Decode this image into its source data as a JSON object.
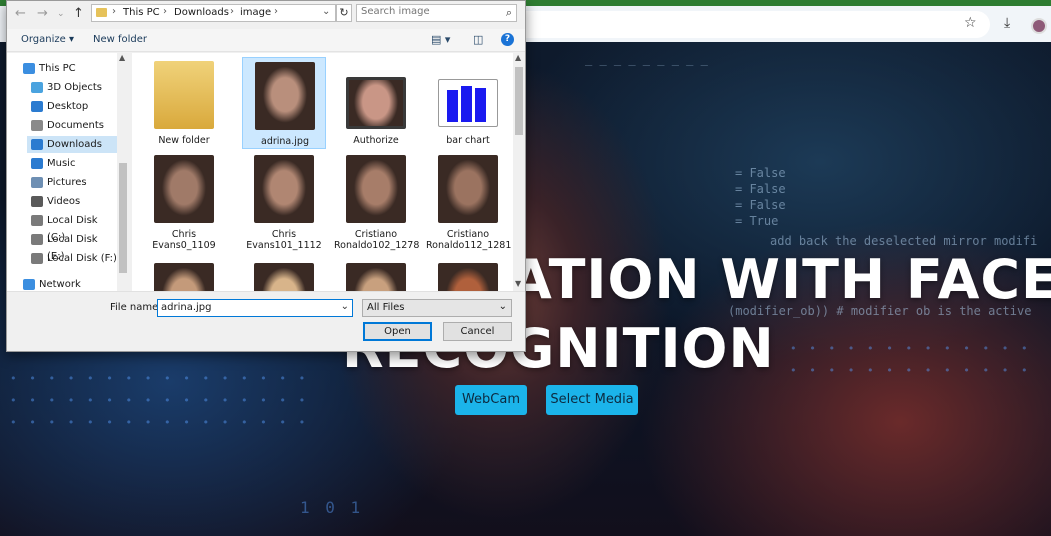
{
  "browser": {
    "colors": {
      "top_strip": "#2e7d32",
      "bar": "#f1f5f9"
    },
    "icons": [
      "star-icon",
      "download-icon",
      "profile-avatar"
    ]
  },
  "page": {
    "headline_line1": "ATION WITH FACE",
    "headline_line2": "RECOGNITION",
    "buttons": {
      "webcam": "WebCam",
      "select_media": "Select Media"
    },
    "accent_color": "#1bb4ea",
    "code_lines": [
      "= False",
      "= False",
      "= False",
      "= True",
      "add back the deselected mirror modifi",
      "(modifier_ob)) # modifier ob is the active"
    ],
    "dots_text": "1 0 1"
  },
  "dialog": {
    "address": {
      "crumbs": [
        "This PC",
        "Downloads",
        "image"
      ]
    },
    "search_placeholder": "Search image",
    "toolbar": {
      "organize": "Organize",
      "new_folder": "New folder",
      "help": "?"
    },
    "sidebar": [
      {
        "label": "This PC",
        "icon": "computer-icon",
        "color": "#3b8ee0"
      },
      {
        "label": "3D Objects",
        "icon": "cube-icon",
        "color": "#4aa3df"
      },
      {
        "label": "Desktop",
        "icon": "desktop-icon",
        "color": "#2b7bd0"
      },
      {
        "label": "Documents",
        "icon": "documents-icon",
        "color": "#8a8a8a"
      },
      {
        "label": "Downloads",
        "icon": "download-arrow-icon",
        "color": "#2b7bd0",
        "selected": true
      },
      {
        "label": "Music",
        "icon": "music-icon",
        "color": "#2b7bd0"
      },
      {
        "label": "Pictures",
        "icon": "pictures-icon",
        "color": "#6e8fb3"
      },
      {
        "label": "Videos",
        "icon": "videos-icon",
        "color": "#5a5a5a"
      },
      {
        "label": "Local Disk (C:)",
        "icon": "disk-icon",
        "color": "#7a7a7a"
      },
      {
        "label": "Local Disk (E:)",
        "icon": "disk-icon",
        "color": "#7a7a7a"
      },
      {
        "label": "Local Disk (F:)",
        "icon": "disk-icon",
        "color": "#7a7a7a"
      },
      {
        "label": "Network",
        "icon": "network-icon",
        "color": "#3b8ee0"
      }
    ],
    "files": [
      {
        "name": "New folder",
        "kind": "folder"
      },
      {
        "name": "adrina.jpg",
        "kind": "photo",
        "selected": true,
        "tone": "#b98f7c"
      },
      {
        "name": "Authorize",
        "kind": "photo-framed",
        "tone": "#c99686"
      },
      {
        "name": "bar chart",
        "kind": "chart"
      },
      {
        "name": "Chris Evans0_1109",
        "kind": "photo",
        "tone": "#a07a68"
      },
      {
        "name": "Chris Evans101_1112",
        "kind": "photo",
        "tone": "#b08672"
      },
      {
        "name": "Cristiano Ronaldo102_1278",
        "kind": "photo",
        "tone": "#a77d69"
      },
      {
        "name": "Cristiano Ronaldo112_1281",
        "kind": "photo",
        "tone": "#9b7360"
      },
      {
        "name": "",
        "kind": "photo",
        "tone": "#c49a7a"
      },
      {
        "name": "",
        "kind": "photo",
        "tone": "#d8b48a"
      },
      {
        "name": "",
        "kind": "photo",
        "tone": "#c8a07e"
      },
      {
        "name": "",
        "kind": "photo",
        "tone": "#b0603c"
      }
    ],
    "file_name_label": "File name:",
    "file_name_value": "adrina.jpg",
    "file_type": "All Files",
    "open_label": "Open",
    "cancel_label": "Cancel"
  }
}
